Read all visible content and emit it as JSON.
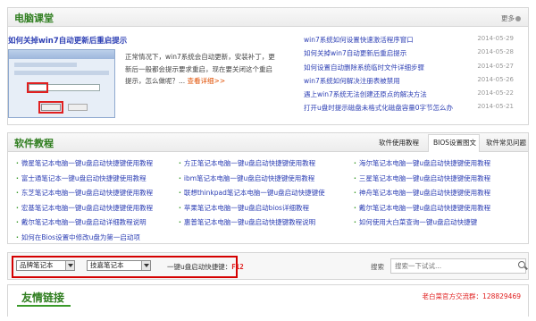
{
  "top_panel": {
    "title": "电脑课堂",
    "more": "更多",
    "feature": {
      "title": "如何关掉win7自动更新后重启提示",
      "desc": "正常情况下，win7系统会自动更新，安装补丁，更新后一般都会提示要求重启，现在要关闭这个重启提示，怎么做呢？... ",
      "link": "查看详细>>"
    },
    "news": [
      {
        "title": "win7系统如何设置快速激活程序窗口",
        "date": "2014-05-29"
      },
      {
        "title": "如何关掉win7自动更新后重启提示",
        "date": "2014-05-28"
      },
      {
        "title": "如何设置自动删除系统临时文件详细步骤",
        "date": "2014-05-27"
      },
      {
        "title": "win7系统如何解决注册表被禁用",
        "date": "2014-05-26"
      },
      {
        "title": "遇上win7系统无法创建还原点的解决方法",
        "date": "2014-05-22"
      },
      {
        "title": "打开u盘时提示磁盘未格式化磁盘容量0字节怎么办",
        "date": "2014-05-21"
      }
    ]
  },
  "software_panel": {
    "title": "软件教程",
    "tabs": [
      "软件使用教程",
      "BIOS设置图文",
      "软件常见问题"
    ],
    "items": [
      [
        "微星笔记本电脑一键u盘启动快捷键使用教程",
        "方正笔记本电脑一键u盘启动快捷键使用教程",
        "海尔笔记本电脑一键u盘启动快捷键使用教程"
      ],
      [
        "富士通笔记本一键u盘启动快捷键使用教程",
        "ibm笔记本电脑一键u盘启动快捷键使用教程",
        "三星笔记本电脑一键u盘启动快捷键使用教程"
      ],
      [
        "东芝笔记本电脑一键u盘启动快捷键使用教程",
        "联想thinkpad笔记本电脑一键u盘启动快捷键使",
        "神舟笔记本电脑一键u盘启动快捷键使用教程"
      ],
      [
        "宏基笔记本电脑一键u盘启动快捷键使用教程",
        "苹果笔记本电脑一键u盘启动bios详细教程",
        "戴尔笔记本电脑一键u盘启动快捷键使用教程"
      ],
      [
        "戴尔笔记本电脑一键u盘启动详细教程说明",
        "惠普笔记本电脑一键u盘启动快捷键教程说明",
        "如何使用大白菜查询一键u盘启动快捷键"
      ],
      [
        "如何在Bios设置中修改u盘为第一启动项",
        "",
        ""
      ]
    ]
  },
  "search_bar": {
    "brand_select": "品牌笔记本",
    "model_select": "技嘉笔记本",
    "key_label": "一键u盘启动快捷键：",
    "key_value": "F12",
    "search_label": "搜索",
    "search_placeholder": "搜索一下试试..."
  },
  "friend_links": {
    "title": "友情链接",
    "qq_label": "老白菜官方交流群：",
    "qq_number": "128829469"
  },
  "colors": {
    "accent_green": "#2e7d1e",
    "link_blue": "#2d3fb4",
    "alert_red": "#d40000"
  }
}
